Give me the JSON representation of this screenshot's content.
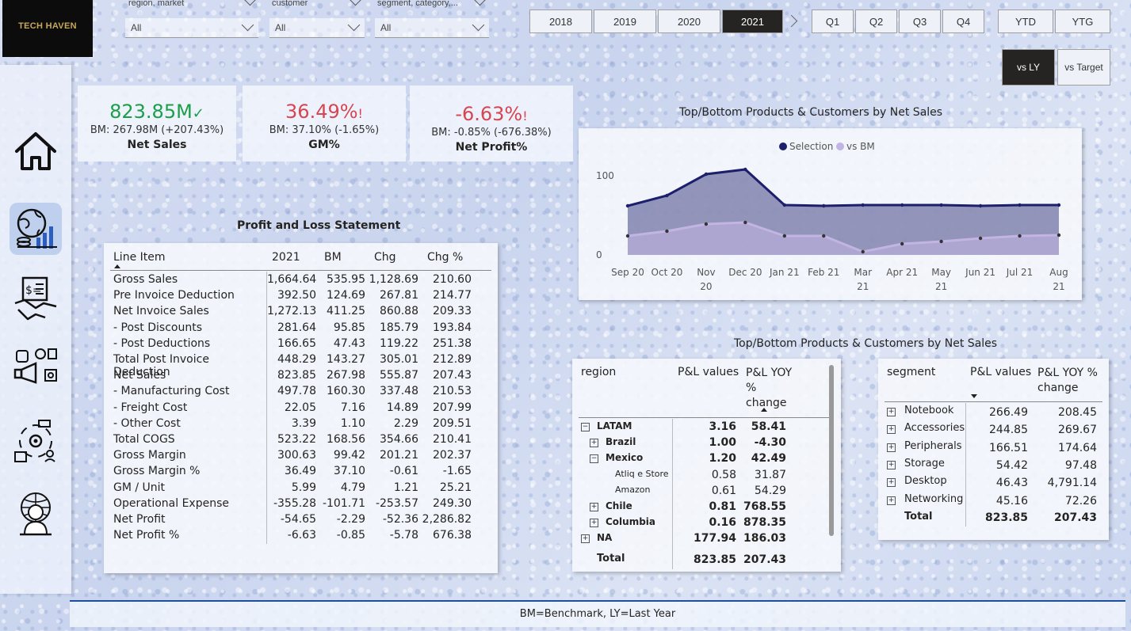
{
  "brand": "TECH HAVEN",
  "slicers": [
    {
      "label": "region, market",
      "value": "All"
    },
    {
      "label": "customer",
      "value": "All"
    },
    {
      "label": "segment, category,...",
      "value": "All"
    }
  ],
  "years": [
    "2018",
    "2019",
    "2020",
    "2021"
  ],
  "selected_year": "2021",
  "quarters": [
    "Q1",
    "Q2",
    "Q3",
    "Q4"
  ],
  "periods": [
    "YTD",
    "YTG"
  ],
  "compare": {
    "vs_ly": "vs LY",
    "vs_target": "vs Target"
  },
  "kpis": [
    {
      "value": "823.85M",
      "status": "✓",
      "bm": "BM: 267.98M (+207.43%)",
      "label": "Net Sales",
      "color": "#1a9e4a"
    },
    {
      "value": "36.49%",
      "status": "!",
      "bm": "BM: 37.10% (-1.65%)",
      "label": "GM%",
      "color": "#d64550"
    },
    {
      "value": "-6.63%",
      "status": "!",
      "bm": "BM: -0.85% (-676.38%)",
      "label": "Net Profit%",
      "color": "#d64550"
    }
  ],
  "pl": {
    "title": "Profit and Loss Statement",
    "headers": [
      "Line Item",
      "2021",
      "BM",
      "Chg",
      "Chg %"
    ],
    "rows": [
      [
        "Gross Sales",
        "1,664.64",
        "535.95",
        "1,128.69",
        "210.60"
      ],
      [
        "Pre Invoice Deduction",
        "392.50",
        "124.69",
        "267.81",
        "214.77"
      ],
      [
        "Net Invoice Sales",
        "1,272.13",
        "411.25",
        "860.88",
        "209.33"
      ],
      [
        "- Post Discounts",
        "281.64",
        "95.85",
        "185.79",
        "193.84"
      ],
      [
        "- Post Deductions",
        "166.65",
        "47.43",
        "119.22",
        "251.38"
      ],
      [
        "Total Post Invoice Deduction",
        "448.29",
        "143.27",
        "305.01",
        "212.89"
      ],
      [
        "Net Sales",
        "823.85",
        "267.98",
        "555.87",
        "207.43"
      ],
      [
        "- Manufacturing Cost",
        "497.78",
        "160.30",
        "337.48",
        "210.53"
      ],
      [
        "- Freight Cost",
        "22.05",
        "7.16",
        "14.89",
        "207.99"
      ],
      [
        "- Other Cost",
        "3.39",
        "1.10",
        "2.29",
        "209.51"
      ],
      [
        "Total COGS",
        "523.22",
        "168.56",
        "354.66",
        "210.41"
      ],
      [
        "Gross Margin",
        "300.63",
        "99.42",
        "201.21",
        "202.37"
      ],
      [
        "Gross Margin %",
        "36.49",
        "37.10",
        "-0.61",
        "-1.65"
      ],
      [
        "GM / Unit",
        "5.99",
        "4.79",
        "1.21",
        "25.21"
      ],
      [
        "Operational Expense",
        "-355.28",
        "-101.71",
        "-253.57",
        "249.30"
      ],
      [
        "Net Profit",
        "-54.65",
        "-2.29",
        "-52.36",
        "2,286.82"
      ],
      [
        "Net Profit %",
        "-6.63",
        "-0.85",
        "-5.78",
        "676.38"
      ]
    ]
  },
  "chart_title": "Top/Bottom Products & Customers by Net Sales",
  "chart_data": {
    "type": "area",
    "title": "Top/Bottom Products & Customers by Net Sales",
    "categories": [
      "Sep 20",
      "Oct 20",
      "Nov 20",
      "Dec 20",
      "Jan 21",
      "Feb 21",
      "Mar 21",
      "Apr 21",
      "May 21",
      "Jun 21",
      "Jul 21",
      "Aug 21"
    ],
    "series": [
      {
        "name": "Selection",
        "values": [
          62,
          75,
          102,
          108,
          63,
          62,
          63,
          63,
          63,
          62,
          63,
          63
        ],
        "color": "#1c1f6b"
      },
      {
        "name": "vs BM",
        "values": [
          24,
          30,
          39,
          41,
          24,
          24,
          4,
          14,
          17,
          21,
          24,
          25
        ],
        "color": "#c2b4e3"
      }
    ],
    "yticks": [
      "0",
      "100"
    ],
    "ylim": [
      0,
      130
    ],
    "legend": "top-center"
  },
  "matrix_title": "Top/Bottom Products & Customers by Net Sales",
  "region_matrix": {
    "headers": [
      "region",
      "P&L values",
      "P&L YOY % change"
    ],
    "rows": [
      {
        "label": "LATAM",
        "v": "3.16",
        "c": "58.41",
        "level": 0,
        "toggle": "−",
        "bold": true
      },
      {
        "label": "Brazil",
        "v": "1.00",
        "c": "-4.30",
        "level": 1,
        "toggle": "+",
        "bold": true
      },
      {
        "label": "Mexico",
        "v": "1.20",
        "c": "42.49",
        "level": 1,
        "toggle": "−",
        "bold": true
      },
      {
        "label": "Atliq e Store",
        "v": "0.58",
        "c": "31.87",
        "level": 2,
        "toggle": "",
        "bold": false
      },
      {
        "label": "Amazon",
        "v": "0.61",
        "c": "54.29",
        "level": 2,
        "toggle": "",
        "bold": false
      },
      {
        "label": "Chile",
        "v": "0.81",
        "c": "768.55",
        "level": 1,
        "toggle": "+",
        "bold": true
      },
      {
        "label": "Columbia",
        "v": "0.16",
        "c": "878.35",
        "level": 1,
        "toggle": "+",
        "bold": true
      },
      {
        "label": "NA",
        "v": "177.94",
        "c": "186.03",
        "level": 0,
        "toggle": "+",
        "bold": true
      }
    ],
    "total": {
      "label": "Total",
      "v": "823.85",
      "c": "207.43"
    }
  },
  "segment_matrix": {
    "headers": [
      "segment",
      "P&L values",
      "P&L YOY % change"
    ],
    "rows": [
      {
        "label": "Notebook",
        "v": "266.49",
        "c": "208.45"
      },
      {
        "label": "Accessories",
        "v": "244.85",
        "c": "269.67"
      },
      {
        "label": "Peripherals",
        "v": "166.51",
        "c": "174.64"
      },
      {
        "label": "Storage",
        "v": "54.42",
        "c": "97.48"
      },
      {
        "label": "Desktop",
        "v": "46.43",
        "c": "4,791.14"
      },
      {
        "label": "Networking",
        "v": "45.16",
        "c": "72.26"
      }
    ],
    "total": {
      "label": "Total",
      "v": "823.85",
      "c": "207.43"
    }
  },
  "footer": "BM=Benchmark, LY=Last Year"
}
